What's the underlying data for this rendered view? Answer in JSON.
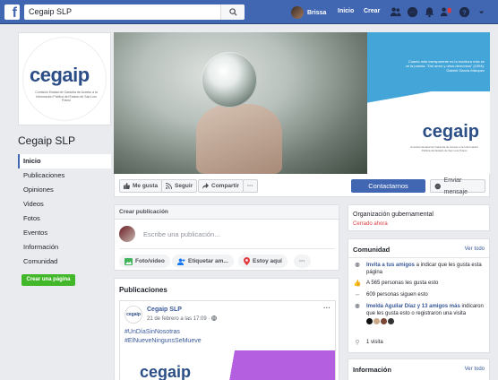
{
  "topbar": {
    "search_value": "Cegaip SLP",
    "user_name": "Brissa",
    "nav_home": "Inicio",
    "nav_create": "Crear",
    "icons": [
      "friends-icon",
      "messenger-icon",
      "notifications-icon",
      "friend-requests-icon",
      "help-icon",
      "dropdown-icon"
    ]
  },
  "page": {
    "name": "Cegaip SLP",
    "logo_text": "cegaip",
    "logo_subtitle": "Comisión Estatal de Garantía de Acceso a la Información Pública del Estado de San Luis Potosí",
    "cover_quote": "Cuanto más transparente es la escritura más se ve la poesía. \"Del amor y otros demonios\" (1994). Gabriel García Márquez",
    "nav": [
      {
        "label": "Inicio",
        "active": true
      },
      {
        "label": "Publicaciones"
      },
      {
        "label": "Opiniones"
      },
      {
        "label": "Videos"
      },
      {
        "label": "Fotos"
      },
      {
        "label": "Eventos"
      },
      {
        "label": "Información"
      },
      {
        "label": "Comunidad"
      }
    ],
    "create_page_label": "Crear una página"
  },
  "actions": {
    "like": "Me gusta",
    "follow": "Seguir",
    "share": "Compartir",
    "more": "···",
    "contact": "Contactarnos",
    "message": "Enviar mensaje"
  },
  "create_post": {
    "header": "Crear publicación",
    "placeholder": "Escribe una publicación...",
    "photo_video": "Foto/video",
    "tag": "Etiquetar am...",
    "checkin": "Estoy aquí",
    "more": "···"
  },
  "posts": {
    "title": "Publicaciones",
    "items": [
      {
        "author": "Cegaip SLP",
        "date": "21 de febrero a las 17:09 · ",
        "hashtag1": "#UnDíaSinNosotras",
        "hashtag2": "#ElNueveNingunsSeMueve",
        "image_logo": "cegaip"
      }
    ]
  },
  "org": {
    "type": "Organización gubernamental",
    "status": "Cerrado ahora"
  },
  "community": {
    "title": "Comunidad",
    "see_all": "Ver todo",
    "invite_link": "Invita a tus amigos",
    "invite_rest": " a indicar que les gusta esta página",
    "likes": "A 565 personas les gusta esto",
    "followers": "609 personas siguen esto",
    "friends_link": "Imelda Aguilar Díaz y 13 amigos más",
    "friends_rest": " indicaron que les gusta esto o registraron una visita",
    "visits": "1 visita"
  },
  "information": {
    "title": "Información",
    "see_all": "Ver todo"
  },
  "colors": {
    "brand": "#4267b2",
    "cover_blue": "#44a6d8",
    "logo_blue": "#2c4e86",
    "green": "#42b72a",
    "closed_red": "#e0393e",
    "post_purple": "#b45ee0"
  }
}
